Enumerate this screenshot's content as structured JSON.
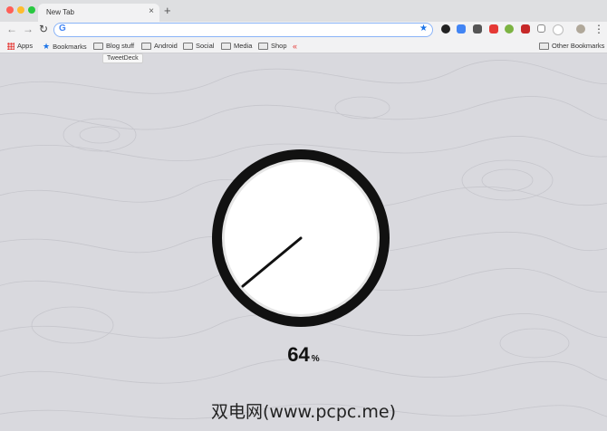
{
  "browser": {
    "tab_title": "New Tab",
    "tab_close": "×",
    "new_tab": "+",
    "back": "←",
    "forward": "→",
    "reload": "↻",
    "omnibox_value": "",
    "menu": "⋮"
  },
  "bookmarks": {
    "items": [
      {
        "label": "Apps",
        "icon": "apps-grid-icon"
      },
      {
        "label": "Bookmarks",
        "icon": "star-icon"
      },
      {
        "label": "Blog stuff",
        "icon": "folder-icon"
      },
      {
        "label": "Android",
        "icon": "folder-icon"
      },
      {
        "label": "Social",
        "icon": "folder-icon"
      },
      {
        "label": "Media",
        "icon": "folder-icon"
      },
      {
        "label": "Shop",
        "icon": "folder-icon"
      }
    ],
    "other": "Other Bookmarks",
    "tooltip": "TweetDeck"
  },
  "gauge": {
    "value": "64",
    "unit": "%",
    "level": 0.64
  },
  "watermark": "双电网(www.pcpc.me)",
  "colors": {
    "accent": "#1a73e8",
    "ring": "#111111",
    "background": "#d9d9de"
  }
}
